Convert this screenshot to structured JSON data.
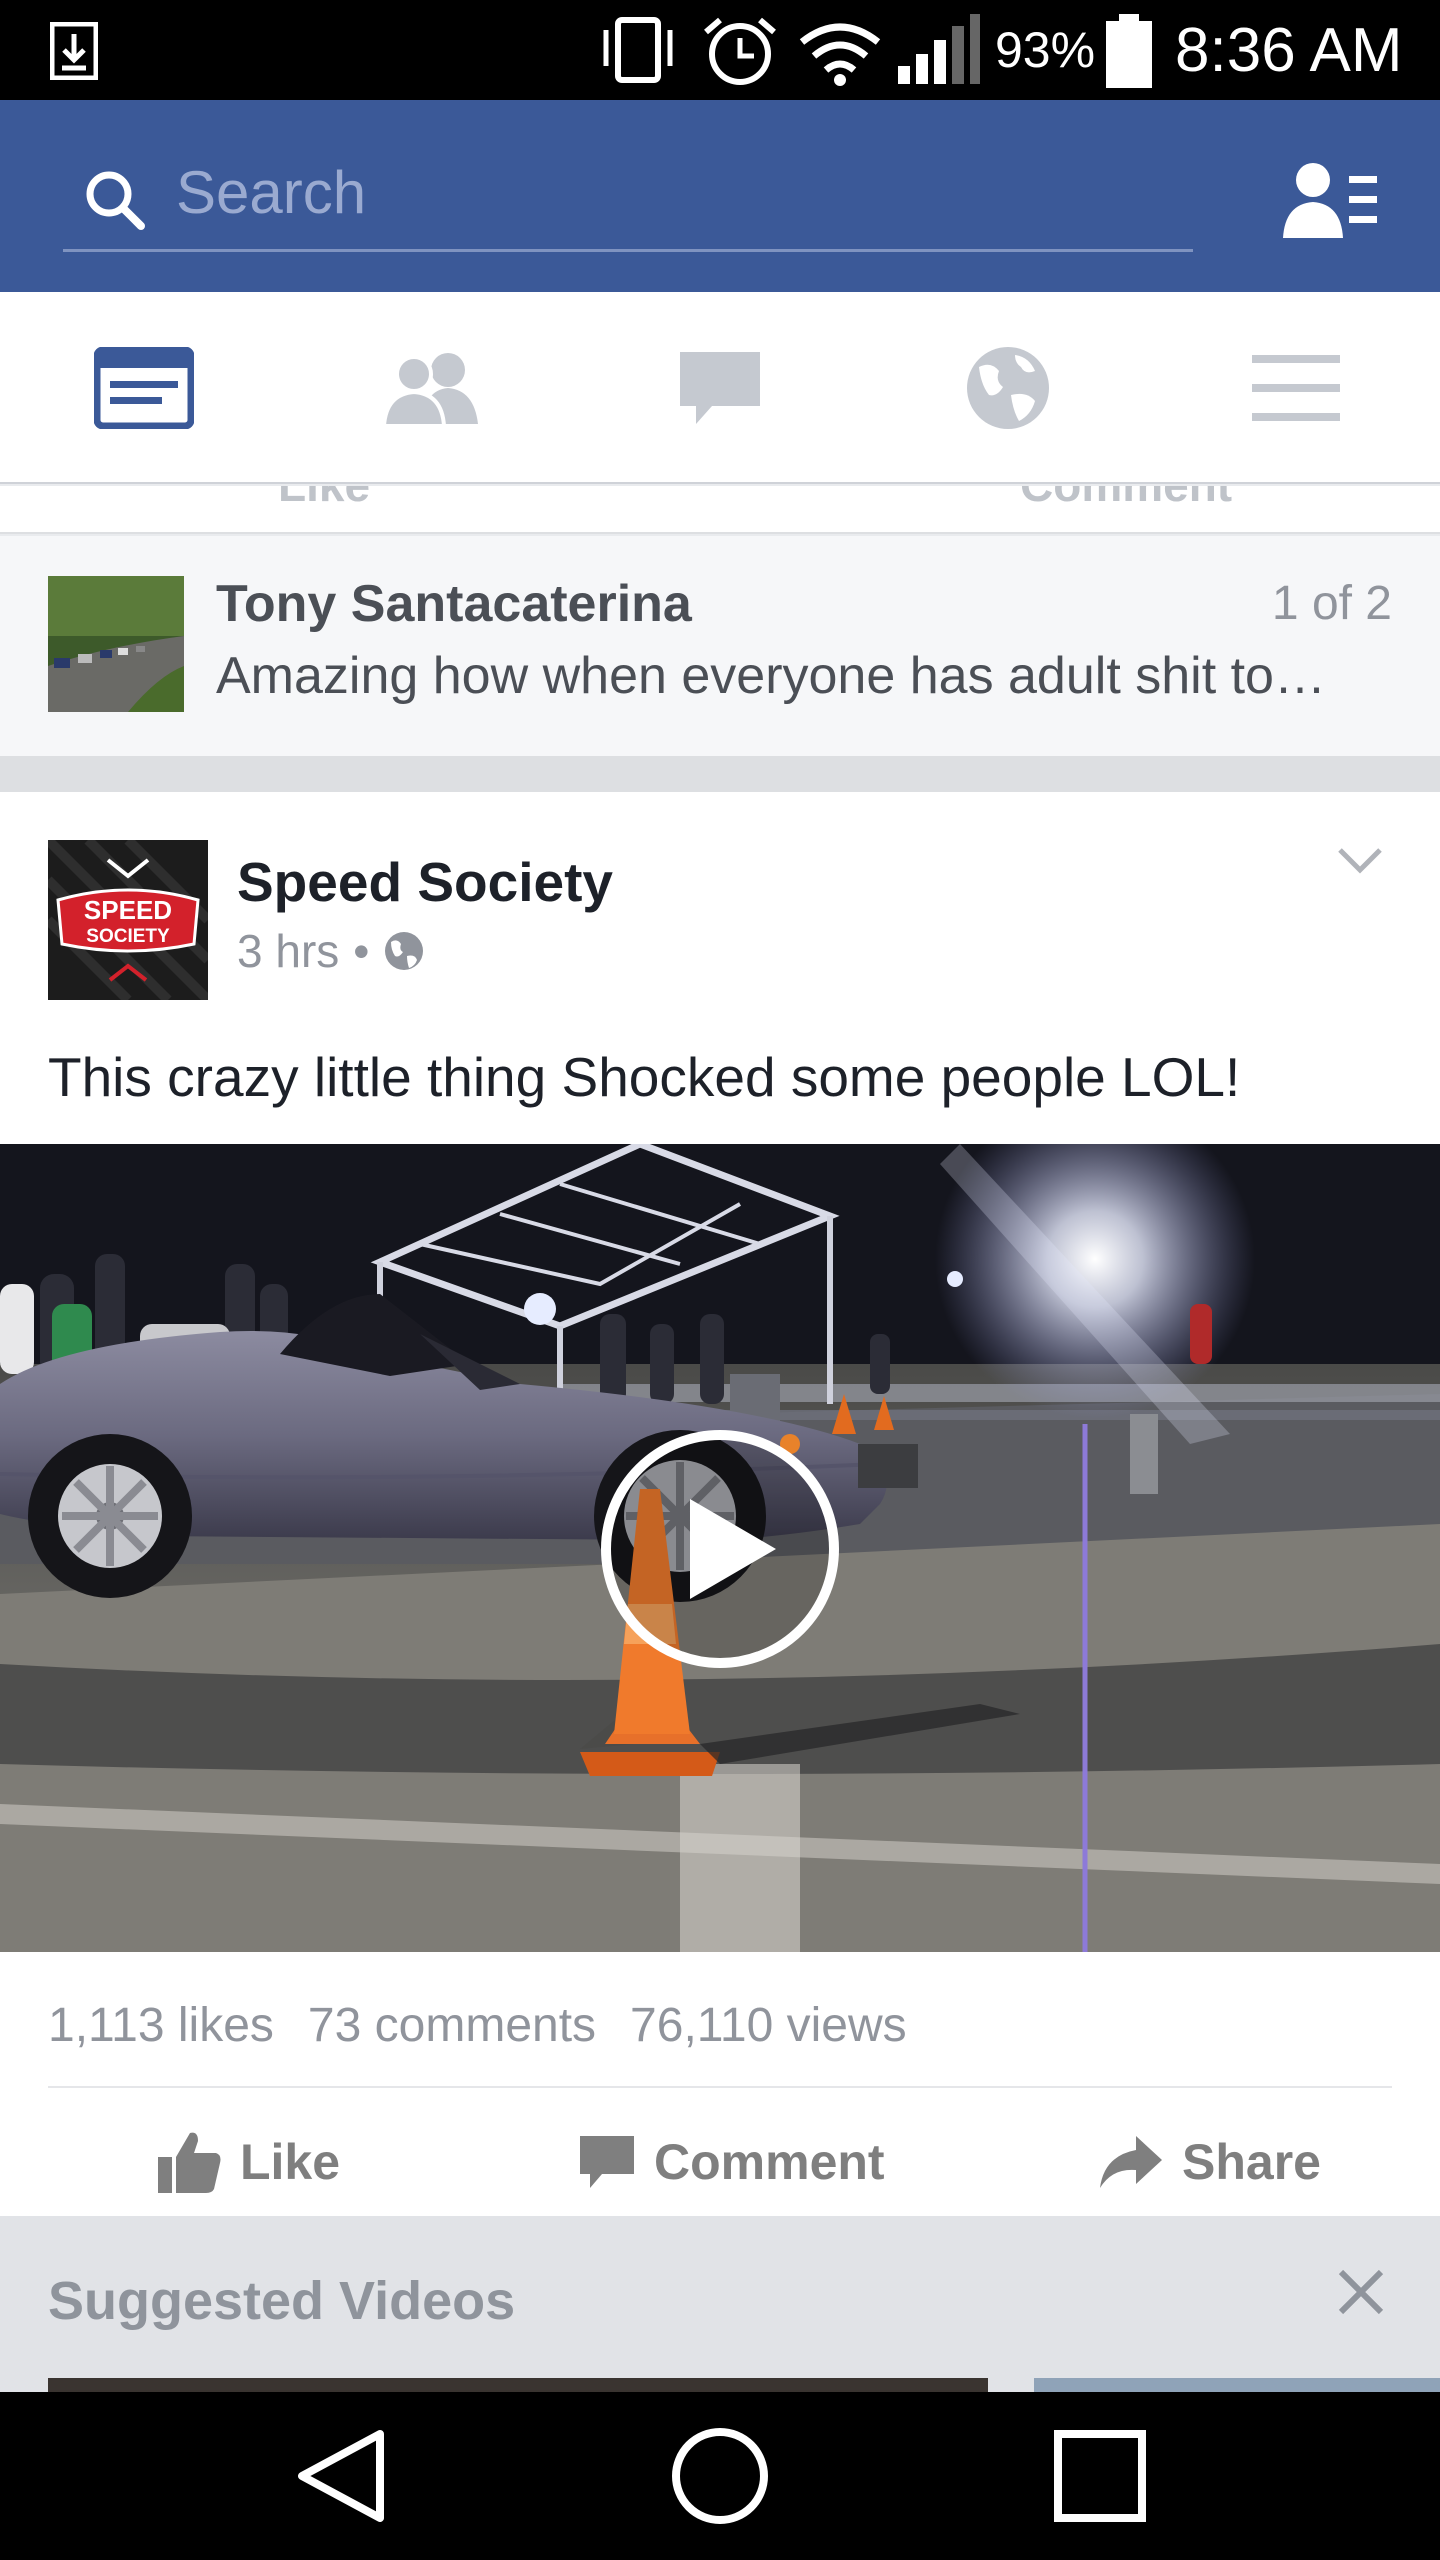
{
  "status_bar": {
    "battery_percent": "93%",
    "time": "8:36 AM",
    "icons": [
      "download-icon",
      "vibrate-icon",
      "alarm-icon",
      "wifi-icon",
      "signal-icon",
      "battery-icon"
    ]
  },
  "search": {
    "placeholder": "Search",
    "icons": [
      "search-icon",
      "friend-requests-icon"
    ]
  },
  "nav_tabs": [
    {
      "name": "news-feed",
      "icon": "news-feed-icon",
      "active": true
    },
    {
      "name": "friends",
      "icon": "friends-icon",
      "active": false
    },
    {
      "name": "messages",
      "icon": "messages-icon",
      "active": false
    },
    {
      "name": "notifications",
      "icon": "globe-icon",
      "active": false
    },
    {
      "name": "more",
      "icon": "menu-icon",
      "active": false
    }
  ],
  "previous_post": {
    "like_label": "Like",
    "comment_label": "Comment"
  },
  "shared_item": {
    "author": "Tony Santacaterina",
    "counter": "1 of 2",
    "text": "Amazing how when everyone has adult shit to…"
  },
  "post": {
    "page_name": "Speed Society",
    "avatar_text": "SPEED SOCIETY",
    "time": "3 hrs",
    "separator": "•",
    "privacy_icon": "globe-icon",
    "text": "This crazy little thing Shocked some people LOL!",
    "stats": {
      "likes": "1,113 likes",
      "comments": "73 comments",
      "views": "76,110 views"
    },
    "actions": {
      "like": "Like",
      "comment": "Comment",
      "share": "Share"
    }
  },
  "suggested": {
    "title": "Suggested Videos",
    "close_icon": "close-icon"
  },
  "android_nav": [
    "back-icon",
    "home-icon",
    "recents-icon"
  ],
  "colors": {
    "brand_blue": "#3b5998",
    "action_gray": "#7f7f7f",
    "meta_gray": "#90949c"
  }
}
